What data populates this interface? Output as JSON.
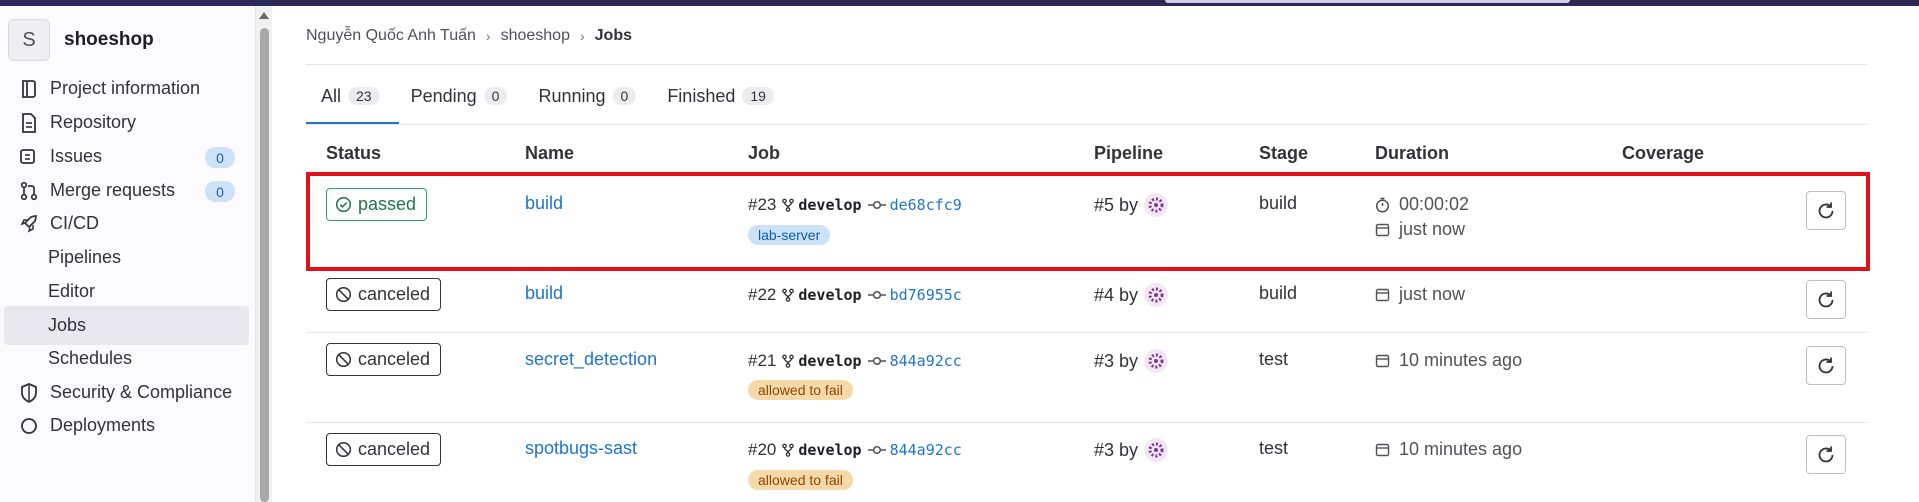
{
  "project": {
    "avatar_letter": "S",
    "name": "shoeshop"
  },
  "sidebar": {
    "items": [
      {
        "label": "Project information",
        "icon": "info-book-icon"
      },
      {
        "label": "Repository",
        "icon": "document-icon"
      },
      {
        "label": "Issues",
        "icon": "issues-icon",
        "count": "0"
      },
      {
        "label": "Merge requests",
        "icon": "merge-request-icon",
        "count": "0"
      },
      {
        "label": "CI/CD",
        "icon": "rocket-icon"
      },
      {
        "label": "Pipelines"
      },
      {
        "label": "Editor"
      },
      {
        "label": "Jobs",
        "active": true
      },
      {
        "label": "Schedules"
      },
      {
        "label": "Security & Compliance",
        "icon": "shield-icon"
      },
      {
        "label": "Deployments",
        "icon": "deployments-icon"
      }
    ]
  },
  "breadcrumb": {
    "owner": "Nguyễn Quốc Anh Tuấn",
    "project": "shoeshop",
    "current": "Jobs"
  },
  "tabs": [
    {
      "label": "All",
      "count": "23",
      "active": true
    },
    {
      "label": "Pending",
      "count": "0"
    },
    {
      "label": "Running",
      "count": "0"
    },
    {
      "label": "Finished",
      "count": "19"
    }
  ],
  "table": {
    "headers": {
      "status": "Status",
      "name": "Name",
      "job": "Job",
      "pipeline": "Pipeline",
      "stage": "Stage",
      "duration": "Duration",
      "coverage": "Coverage"
    },
    "rows": [
      {
        "status": "passed",
        "name": "build",
        "job_id": "#23",
        "branch": "develop",
        "sha": "de68cfc9",
        "tag": "lab-server",
        "pipeline": "#5 by",
        "stage": "build",
        "duration": "00:00:02",
        "finished": "just now"
      },
      {
        "status": "canceled",
        "name": "build",
        "job_id": "#22",
        "branch": "develop",
        "sha": "bd76955c",
        "pipeline": "#4 by",
        "stage": "build",
        "finished": "just now"
      },
      {
        "status": "canceled",
        "name": "secret_detection",
        "job_id": "#21",
        "branch": "develop",
        "sha": "844a92cc",
        "tag": "allowed to fail",
        "pipeline": "#3 by",
        "stage": "test",
        "finished": "10 minutes ago"
      },
      {
        "status": "canceled",
        "name": "spotbugs-sast",
        "job_id": "#20",
        "branch": "develop",
        "sha": "844a92cc",
        "tag": "allowed to fail",
        "pipeline": "#3 by",
        "stage": "test",
        "finished": "10 minutes ago"
      }
    ]
  },
  "colors": {
    "accent": "#1f75cb",
    "passed": "#217645",
    "highlight": "#e3101c",
    "topbar": "#2b2a57"
  }
}
